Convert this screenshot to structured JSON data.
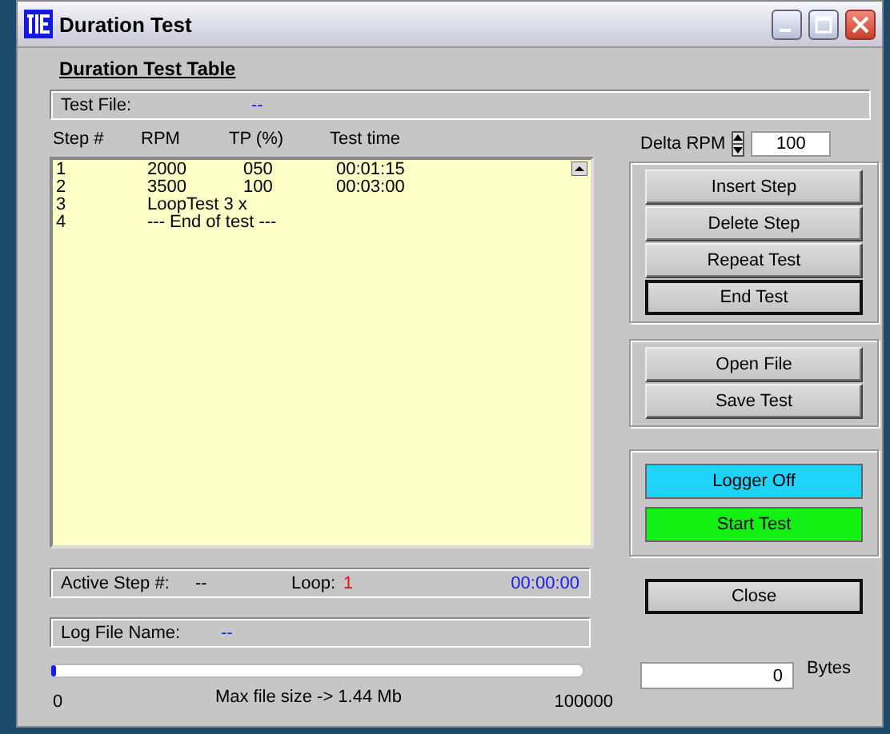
{
  "window": {
    "title": "Duration Test"
  },
  "section_title": "Duration Test Table",
  "test_file": {
    "label": "Test File:",
    "value": "--"
  },
  "table": {
    "columns": [
      "Step #",
      "RPM",
      "TP (%)",
      "Test time"
    ],
    "rows": [
      {
        "kind": "step",
        "cells": [
          "1",
          "2000",
          "050",
          "00:01:15"
        ]
      },
      {
        "kind": "step",
        "cells": [
          "2",
          "3500",
          "100",
          "00:03:00"
        ]
      },
      {
        "kind": "note",
        "cells": [
          "3",
          "LoopTest 3 x"
        ]
      },
      {
        "kind": "note",
        "cells": [
          "4",
          "--- End of test ---"
        ]
      }
    ]
  },
  "delta_rpm": {
    "label": "Delta RPM",
    "value": "100"
  },
  "button_groups": [
    [
      {
        "label": "Insert Step",
        "focused": false
      },
      {
        "label": "Delete Step",
        "focused": false
      },
      {
        "label": "Repeat Test",
        "focused": false
      },
      {
        "label": "End Test",
        "focused": true
      }
    ],
    [
      {
        "label": "Open File",
        "focused": false
      },
      {
        "label": "Save Test",
        "focused": false
      }
    ]
  ],
  "status_buttons": [
    {
      "label": "Logger Off",
      "color": "#1ed2fa"
    },
    {
      "label": "Start Test",
      "color": "#14f014"
    }
  ],
  "active_step": {
    "label": "Active Step #:",
    "value": "--",
    "loop_label": "Loop:",
    "loop_value": "1",
    "time": "00:00:00"
  },
  "close_button": "Close",
  "log_file": {
    "label": "Log File Name:",
    "value": "--"
  },
  "file_size": {
    "level": 0.01,
    "min": "0",
    "caption": "Max file size -> 1.44 Mb",
    "max": "100000"
  },
  "bytes": {
    "value": "0",
    "unit": "Bytes"
  }
}
